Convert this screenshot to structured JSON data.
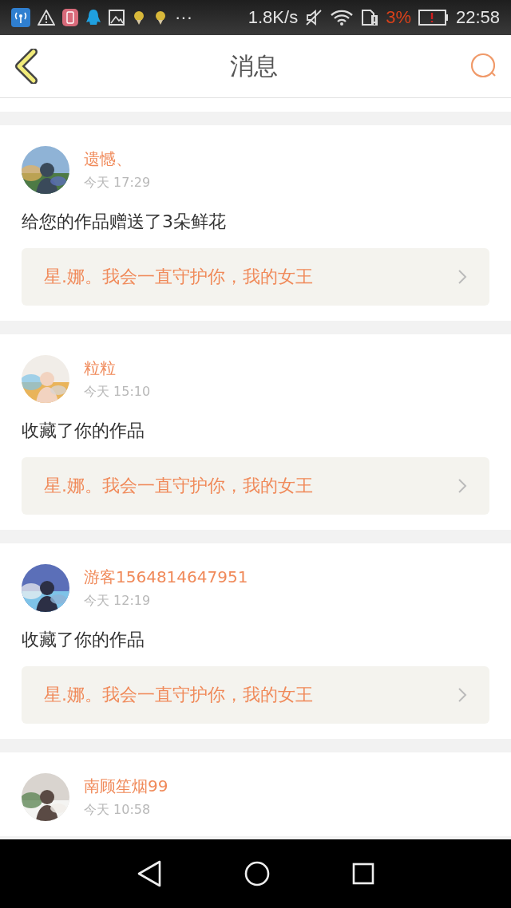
{
  "status_bar": {
    "more": "···",
    "network_speed": "1.8K/s",
    "battery_percent": "3%",
    "time": "22:58"
  },
  "header": {
    "title": "消息"
  },
  "messages": [
    {
      "user": "遗憾、",
      "time": "今天 17:29",
      "text": "给您的作品赠送了3朵鲜花",
      "quote": "星.娜。我会一直守护你，我的女王"
    },
    {
      "user": "粒粒",
      "time": "今天 15:10",
      "text": "收藏了你的作品",
      "quote": "星.娜。我会一直守护你，我的女王"
    },
    {
      "user": "游客1564814647951",
      "time": "今天 12:19",
      "text": "收藏了你的作品",
      "quote": "星.娜。我会一直守护你，我的女王"
    },
    {
      "user": "南顾笙烟99",
      "time": "今天 10:58"
    }
  ]
}
